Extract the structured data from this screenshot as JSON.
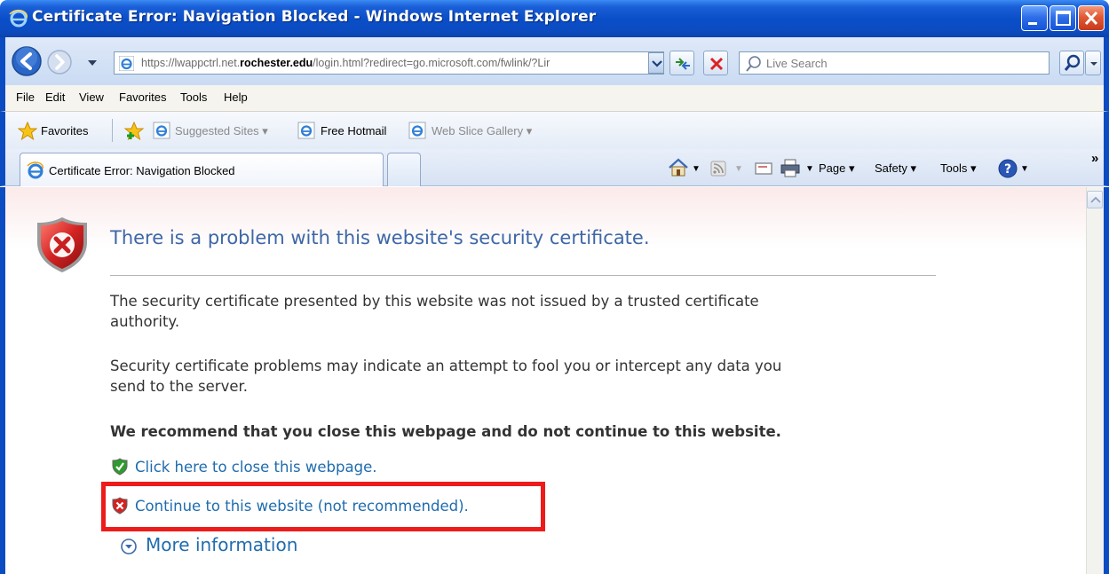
{
  "window": {
    "title": "Certificate Error: Navigation Blocked - Windows Internet Explorer"
  },
  "address_bar": {
    "url_prefix": "https://lwappctrl.net.",
    "url_domain": "rochester.edu",
    "url_suffix": "/login.html?redirect=go.microsoft.com/fwlink/?Lir",
    "search_placeholder": "Live Search"
  },
  "menu": {
    "items": [
      "File",
      "Edit",
      "View",
      "Favorites",
      "Tools",
      "Help"
    ]
  },
  "favorites_bar": {
    "favorites_label": "Favorites",
    "items": [
      {
        "label": "Suggested Sites",
        "has_dropdown": true,
        "dimmed": true
      },
      {
        "label": "Free Hotmail",
        "has_dropdown": false,
        "dimmed": false
      },
      {
        "label": "Web Slice Gallery",
        "has_dropdown": true,
        "dimmed": true
      }
    ]
  },
  "tabs": {
    "active_title": "Certificate Error: Navigation Blocked"
  },
  "command_bar": {
    "page_label": "Page",
    "safety_label": "Safety",
    "tools_label": "Tools",
    "overflow": "»"
  },
  "content": {
    "heading": "There is a problem with this website's security certificate.",
    "para1_line1": "The security certificate presented by this website was not issued by a trusted certificate",
    "para1_line2": "authority.",
    "para2_line1": "Security certificate problems may indicate an attempt to fool you or intercept any data you",
    "para2_line2": "send to the server.",
    "recommendation": "We recommend that you close this webpage and do not continue to this website.",
    "close_link": "Click here to close this webpage.",
    "continue_link": "Continue to this website (not recommended).",
    "more_info": "More information"
  },
  "colors": {
    "titlebar": "#0b4cc2",
    "heading": "#3d67a7",
    "link": "#1f6cae",
    "highlight": "#ee1b1b"
  }
}
